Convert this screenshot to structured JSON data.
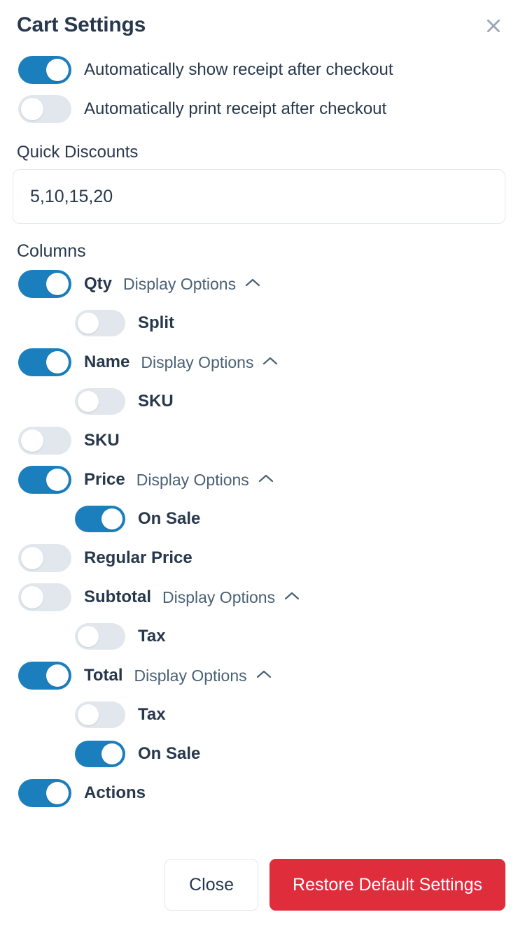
{
  "dialog": {
    "title": "Cart Settings",
    "close_icon": "close-icon"
  },
  "receipt_options": [
    {
      "label": "Automatically show receipt after checkout",
      "on": true
    },
    {
      "label": "Automatically print receipt after checkout",
      "on": false
    }
  ],
  "quick_discounts": {
    "label": "Quick Discounts",
    "value": "5,10,15,20",
    "placeholder": "5,10,15,20"
  },
  "columns": {
    "heading": "Columns",
    "display_options_label": "Display Options",
    "chevron_icon": "chevron-up-icon",
    "items": [
      {
        "label": "Qty",
        "on": true,
        "has_display_options": true,
        "children": [
          {
            "label": "Split",
            "on": false
          }
        ]
      },
      {
        "label": "Name",
        "on": true,
        "has_display_options": true,
        "children": [
          {
            "label": "SKU",
            "on": false
          }
        ]
      },
      {
        "label": "SKU",
        "on": false,
        "has_display_options": false,
        "children": []
      },
      {
        "label": "Price",
        "on": true,
        "has_display_options": true,
        "children": [
          {
            "label": "On Sale",
            "on": true
          }
        ]
      },
      {
        "label": "Regular Price",
        "on": false,
        "has_display_options": false,
        "children": []
      },
      {
        "label": "Subtotal",
        "on": false,
        "has_display_options": true,
        "children": [
          {
            "label": "Tax",
            "on": false
          }
        ]
      },
      {
        "label": "Total",
        "on": true,
        "has_display_options": true,
        "children": [
          {
            "label": "Tax",
            "on": false
          },
          {
            "label": "On Sale",
            "on": true
          }
        ]
      },
      {
        "label": "Actions",
        "on": true,
        "has_display_options": false,
        "children": []
      }
    ]
  },
  "footer": {
    "close_label": "Close",
    "restore_label": "Restore Default Settings"
  },
  "colors": {
    "accent": "#1b7fbd",
    "danger": "#e02d3c",
    "text": "#27384c",
    "muted": "#4a6175",
    "toggle_off": "#e2e7ee",
    "border": "#e3e8ef"
  }
}
